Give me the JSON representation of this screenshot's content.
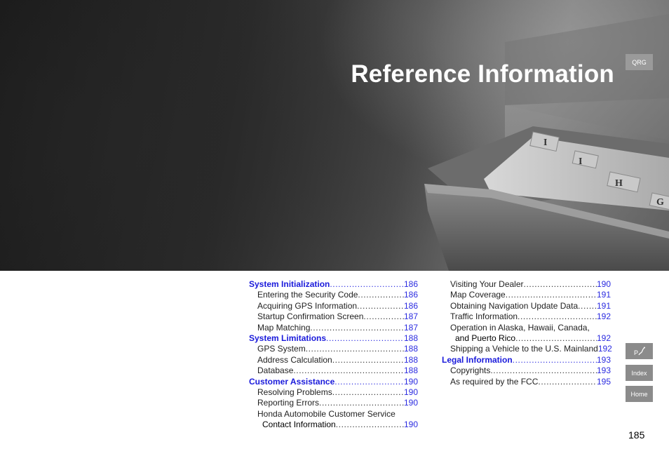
{
  "title": "Reference Information",
  "side_tabs": {
    "qrg": "QRG",
    "index": "Index",
    "home": "Home"
  },
  "toc_left": [
    {
      "type": "head",
      "label": "System Initialization",
      "page": "186"
    },
    {
      "type": "sub",
      "label": "Entering the Security Code",
      "page": "186"
    },
    {
      "type": "sub",
      "label": "Acquiring GPS Information",
      "page": "186"
    },
    {
      "type": "sub",
      "label": "Startup Confirmation Screen",
      "page": "187"
    },
    {
      "type": "sub",
      "label": "Map Matching",
      "page": "187"
    },
    {
      "type": "head",
      "label": "System Limitations",
      "page": "188"
    },
    {
      "type": "sub",
      "label": "GPS System",
      "page": "188"
    },
    {
      "type": "sub",
      "label": "Address Calculation",
      "page": "188"
    },
    {
      "type": "sub",
      "label": "Database",
      "page": "188"
    },
    {
      "type": "head",
      "label": "Customer Assistance",
      "page": "190"
    },
    {
      "type": "sub",
      "label": "Resolving Problems",
      "page": "190"
    },
    {
      "type": "sub",
      "label": "Reporting Errors",
      "page": "190"
    },
    {
      "type": "plain",
      "label": "Honda Automobile Customer Service"
    },
    {
      "type": "cont",
      "label": "Contact Information",
      "page": "190"
    }
  ],
  "toc_right": [
    {
      "type": "sub",
      "label": "Visiting Your Dealer",
      "page": "190"
    },
    {
      "type": "sub",
      "label": "Map Coverage",
      "page": "191"
    },
    {
      "type": "sub",
      "label": "Obtaining Navigation Update Data",
      "page": "191"
    },
    {
      "type": "sub",
      "label": "Traffic Information",
      "page": "192"
    },
    {
      "type": "plain",
      "label": "Operation in Alaska, Hawaii, Canada,"
    },
    {
      "type": "cont",
      "label": "and Puerto Rico",
      "page": "192"
    },
    {
      "type": "sub",
      "label": "Shipping a Vehicle to the U.S. Mainland",
      "page": "192"
    },
    {
      "type": "head",
      "label": "Legal Information",
      "page": "193"
    },
    {
      "type": "sub",
      "label": "Copyrights",
      "page": "193"
    },
    {
      "type": "sub",
      "label": "As required by the FCC",
      "page": "195"
    }
  ],
  "page_number": "185"
}
